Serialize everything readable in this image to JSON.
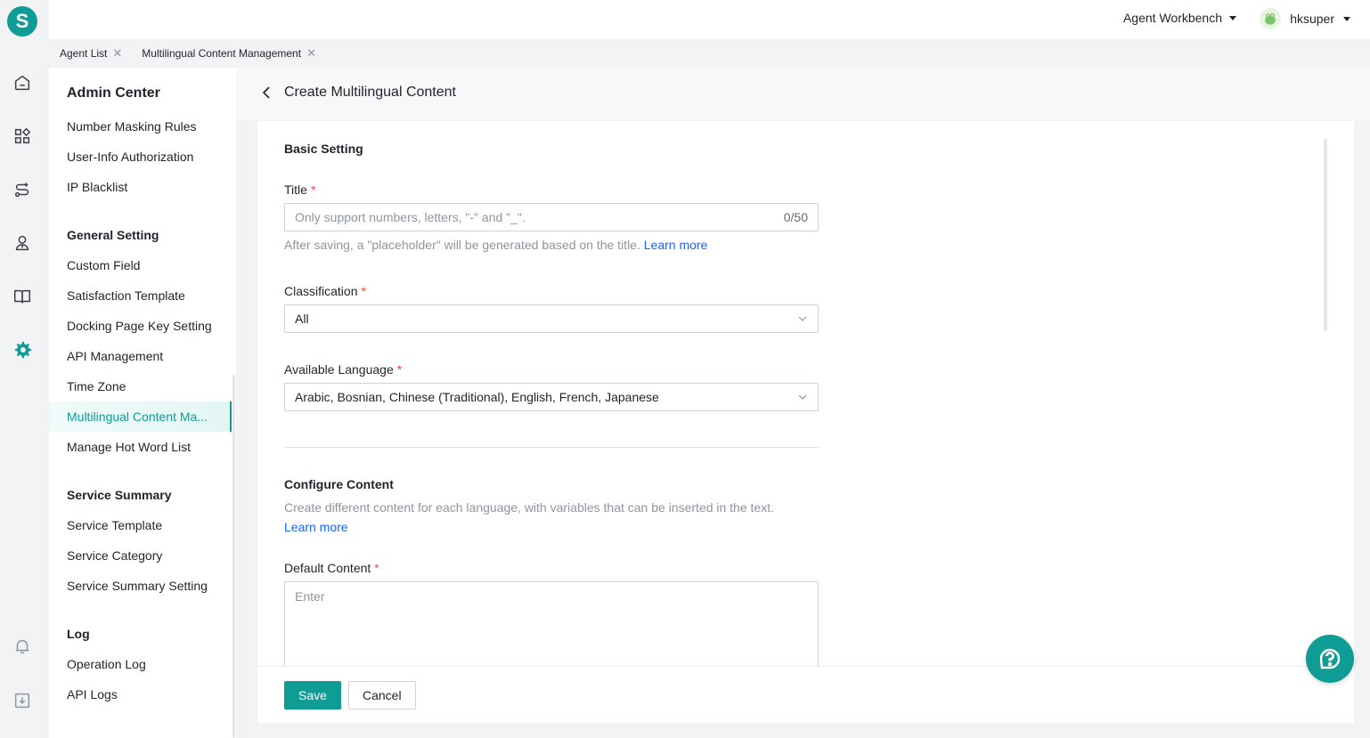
{
  "logo": {
    "letter": "S",
    "color": "#0f9c94"
  },
  "rail": {
    "icons": [
      "home-icon",
      "apps-icon",
      "route-icon",
      "user-group-icon",
      "book-icon",
      "gear-icon",
      "bell-icon",
      "download-icon"
    ],
    "active": "gear-icon"
  },
  "topbar": {
    "workbench_label": "Agent Workbench",
    "username": "hksuper"
  },
  "tabs": [
    {
      "label": "Agent List"
    },
    {
      "label": "Multilingual Content Management"
    }
  ],
  "sidebar": {
    "title": "Admin Center",
    "items_top": [
      "Number Masking Rules",
      "User-Info Authorization",
      "IP Blacklist"
    ],
    "general_setting": {
      "label": "General Setting",
      "items": [
        "Custom Field",
        "Satisfaction Template",
        "Docking Page Key Setting",
        "API Management",
        "Time Zone",
        "Multilingual Content Ma...",
        "Manage Hot Word List"
      ]
    },
    "service_summary": {
      "label": "Service Summary",
      "items": [
        "Service Template",
        "Service Category",
        "Service Summary Setting"
      ]
    },
    "log": {
      "label": "Log",
      "items": [
        "Operation Log",
        "API Logs"
      ]
    }
  },
  "page": {
    "title": "Create Multilingual Content"
  },
  "form": {
    "basic_setting": "Basic Setting",
    "title_label": "Title",
    "title_placeholder": "Only support numbers, letters, \"-\" and \"_\".",
    "title_counter": "0/50",
    "title_hint": "After saving, a \"placeholder\" will be generated based on the title.",
    "learn_more": "Learn more",
    "classification_label": "Classification",
    "classification_value": "All",
    "language_label": "Available Language",
    "language_value": "Arabic, Bosnian, Chinese (Traditional), English, French, Japanese",
    "configure_content": "Configure Content",
    "configure_hint": "Create different content for each language, with variables that can be inserted in the text.",
    "default_content_label": "Default Content",
    "default_content_placeholder": "Enter",
    "required_mark": "*"
  },
  "footer": {
    "save_label": "Save",
    "cancel_label": "Cancel"
  },
  "colors": {
    "accent": "#0f9c94",
    "link": "#1664ff",
    "required": "#f54a45"
  }
}
